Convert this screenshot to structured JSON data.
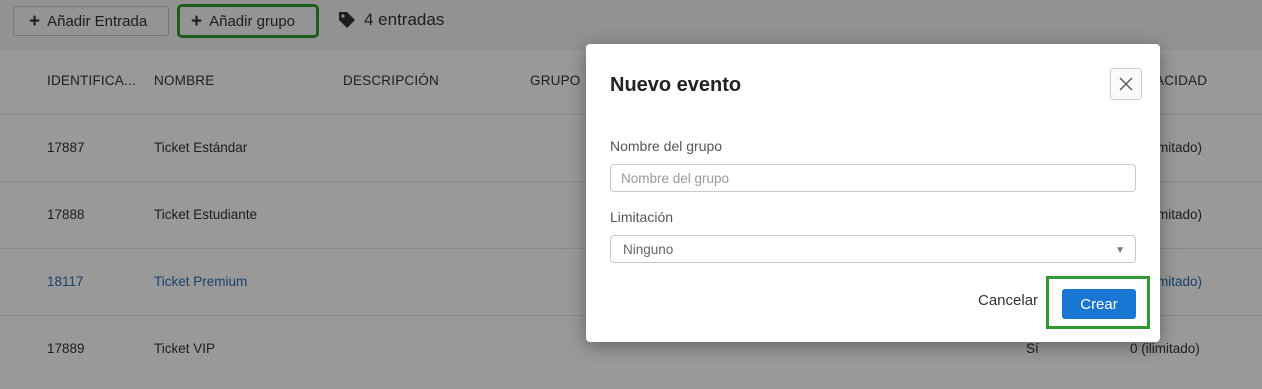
{
  "toolbar": {
    "add_entry_label": "Añadir Entrada",
    "add_group_label": "Añadir grupo",
    "entries_count": "4 entradas"
  },
  "table": {
    "columns": [
      "IDENTIFICA...",
      "NOMBRE",
      "DESCRIPCIÓN",
      "GRUPO",
      "ACIDAD"
    ],
    "rows": [
      {
        "id": "17887",
        "name": "Ticket Estándar",
        "capacity": "mitado)"
      },
      {
        "id": "17888",
        "name": "Ticket Estudiante",
        "capacity": "mitado)"
      },
      {
        "id": "18117",
        "name": "Ticket Premium",
        "capacity": "mitado)"
      },
      {
        "id": "17889",
        "name": "Ticket VIP",
        "col_extra": "Sí",
        "capacity": "0 (ilimitado)"
      }
    ]
  },
  "modal": {
    "title": "Nuevo evento",
    "group_name_label": "Nombre del grupo",
    "group_name_placeholder": "Nombre del grupo",
    "limitation_label": "Limitación",
    "limitation_value": "Ninguno",
    "cancel_label": "Cancelar",
    "create_label": "Crear"
  },
  "colors": {
    "highlight": "#2f9a2f",
    "primary": "#1976d2",
    "link": "#2a6fb5"
  }
}
